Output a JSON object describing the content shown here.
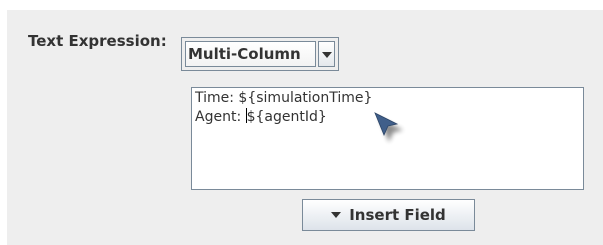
{
  "text_expression": {
    "label": "Text Expression:",
    "mode_selected": "Multi-Column",
    "mode_dropdown_icon": "chevron-down-icon"
  },
  "editor": {
    "lines": [
      "Time: ${simulationTime}",
      "Agent: ",
      "${agentId}"
    ]
  },
  "insert_field": {
    "label": "Insert Field",
    "icon": "triangle-down-icon"
  },
  "colors": {
    "panel_background": "#eeeeee",
    "border": "#7a8a99",
    "text": "#333333"
  }
}
